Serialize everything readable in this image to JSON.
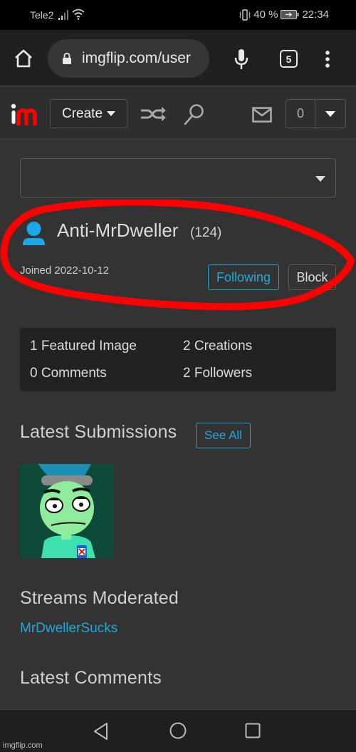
{
  "status_bar": {
    "carrier": "Tele2",
    "battery_percent": "40 %",
    "time": "22:34"
  },
  "browser": {
    "url": "imgflip.com/user",
    "tab_count": "5"
  },
  "site_header": {
    "create_label": "Create",
    "notification_count": "0"
  },
  "profile": {
    "username": "Anti-MrDweller",
    "points": "(124)",
    "joined": "Joined 2022-10-12",
    "following_label": "Following",
    "block_label": "Block"
  },
  "stats": [
    "1 Featured Image",
    "2 Creations",
    "0 Comments",
    "2 Followers"
  ],
  "sections": {
    "latest_submissions": "Latest Submissions",
    "see_all_label": "See All",
    "streams_moderated": "Streams Moderated",
    "streams": [
      "MrDwellerSucks"
    ],
    "latest_comments": "Latest Comments"
  },
  "annotation": {
    "color": "#ff0000"
  },
  "colors": {
    "accent": "#22a8d8",
    "logo_red": "#ff0000",
    "background": "#333333"
  },
  "watermark": "imgflip.com"
}
